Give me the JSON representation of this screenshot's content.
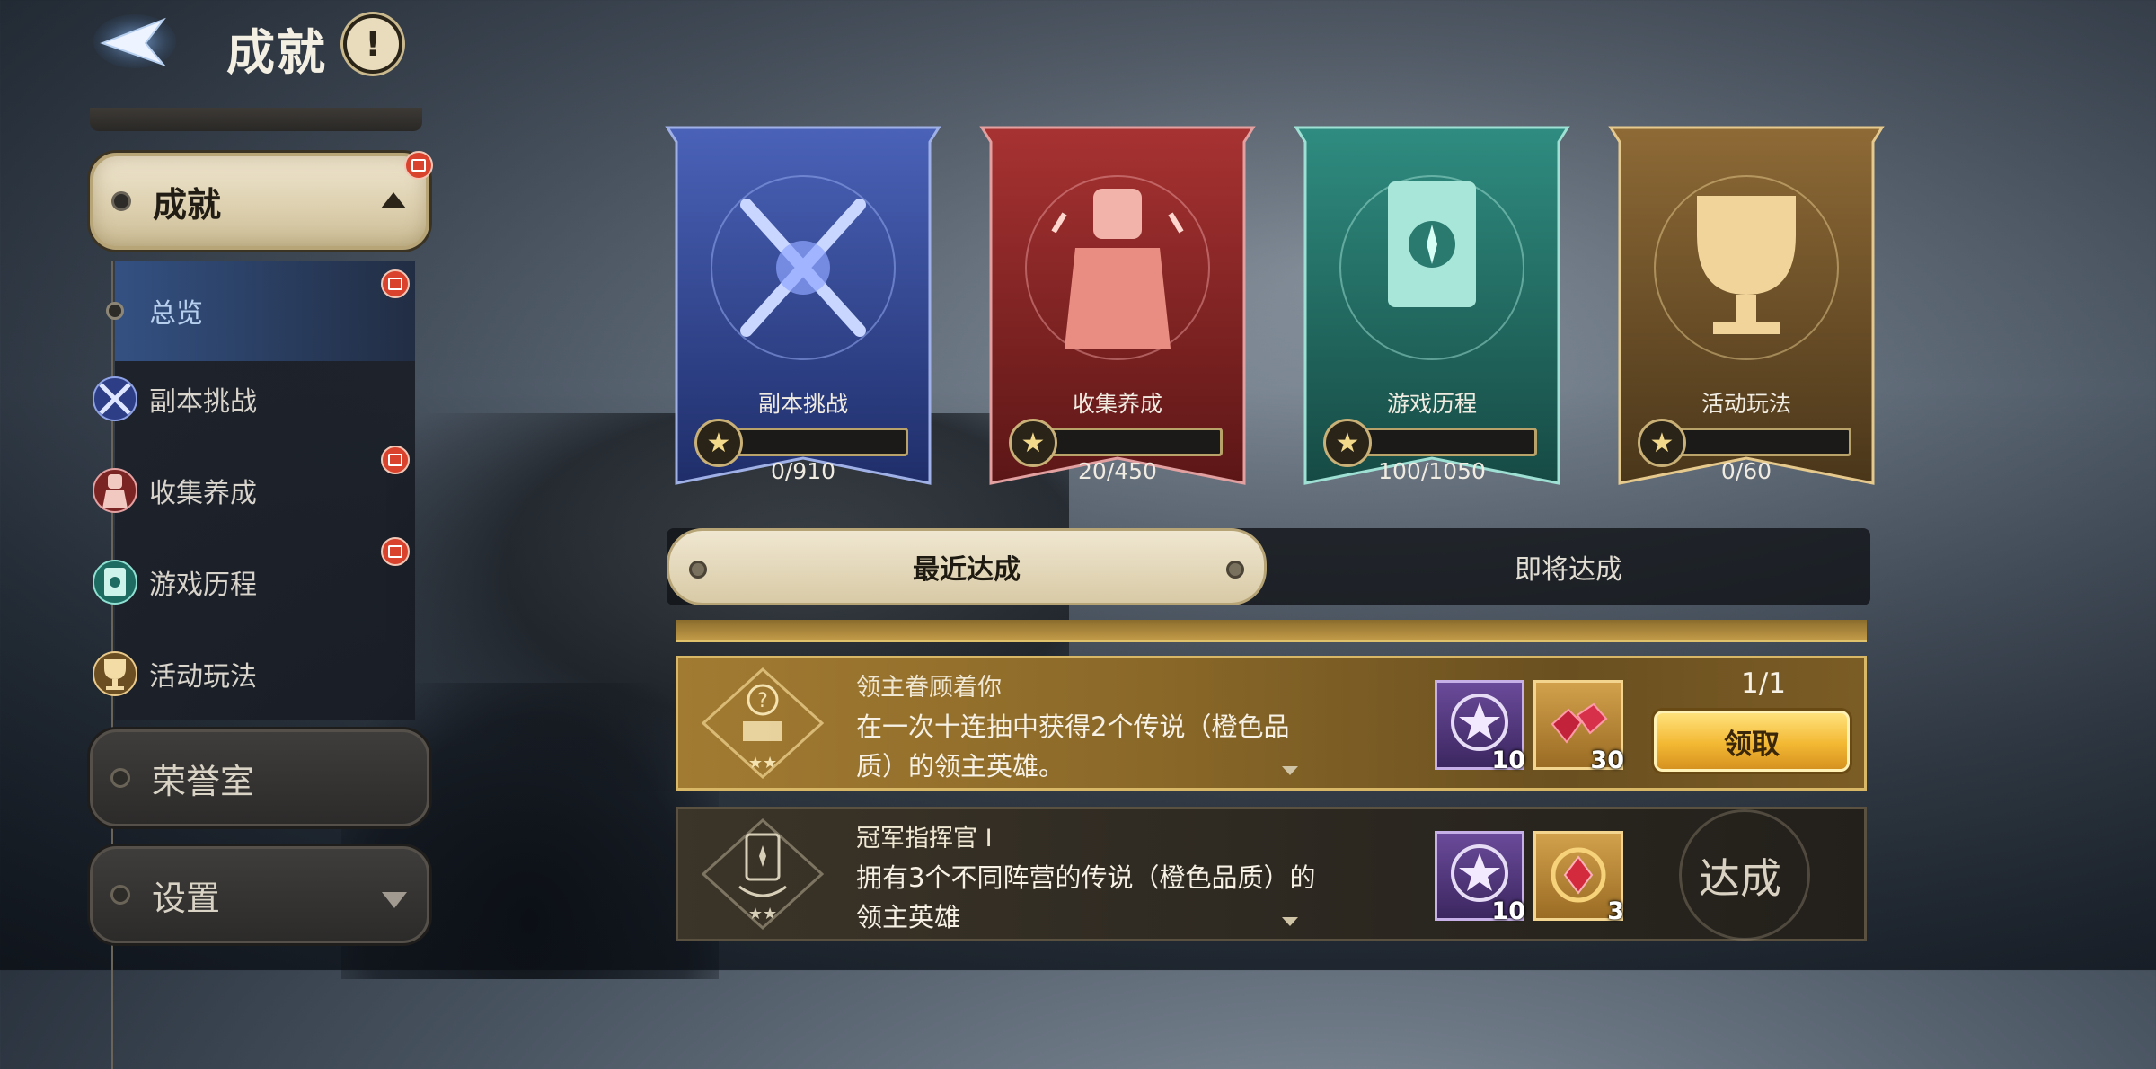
{
  "header": {
    "title": "成就",
    "info_glyph": "!"
  },
  "sidebar": {
    "main_item": {
      "label": "成就"
    },
    "sub_items": [
      {
        "label": "总览",
        "active": true,
        "badge": true
      },
      {
        "label": "副本挑战",
        "icon": "crossed-swords-icon",
        "badge": false
      },
      {
        "label": "收集养成",
        "icon": "knight-icon",
        "badge": true
      },
      {
        "label": "游戏历程",
        "icon": "book-icon",
        "badge": true
      },
      {
        "label": "活动玩法",
        "icon": "trophy-icon",
        "badge": false
      }
    ],
    "honor": {
      "label": "荣誉室"
    },
    "settings": {
      "label": "设置"
    }
  },
  "categories": [
    {
      "name": "副本挑战",
      "progress": "0/910",
      "fill": 0,
      "color": "#2e4aa0",
      "icon": "crossed-swords-icon"
    },
    {
      "name": "收集养成",
      "progress": "20/450",
      "fill": 0.04,
      "color": "#8e2424",
      "icon": "knight-icon"
    },
    {
      "name": "游戏历程",
      "progress": "100/1050",
      "fill": 0.1,
      "color": "#1f6e66",
      "icon": "book-icon"
    },
    {
      "name": "活动玩法",
      "progress": "0/60",
      "fill": 0,
      "color": "#7a5a2a",
      "icon": "trophy-icon"
    }
  ],
  "tabs": {
    "recent": "最近达成",
    "upcoming": "即将达成"
  },
  "achievements": [
    {
      "title": "领主眷顾着你",
      "desc": "在一次十连抽中获得2个传说（橙色品质）的领主英雄。",
      "rewards": [
        {
          "icon": "star-wreath-icon",
          "count": "10"
        },
        {
          "icon": "red-gem-icon",
          "count": "30"
        }
      ],
      "progress": "1/1",
      "action": "领取"
    },
    {
      "title": "冠军指挥官 I",
      "desc": "拥有3个不同阵营的传说（橙色品质）的领主英雄",
      "rewards": [
        {
          "icon": "star-wreath-icon",
          "count": "10"
        },
        {
          "icon": "ruby-amulet-icon",
          "count": "3"
        }
      ],
      "status": "达成"
    }
  ]
}
